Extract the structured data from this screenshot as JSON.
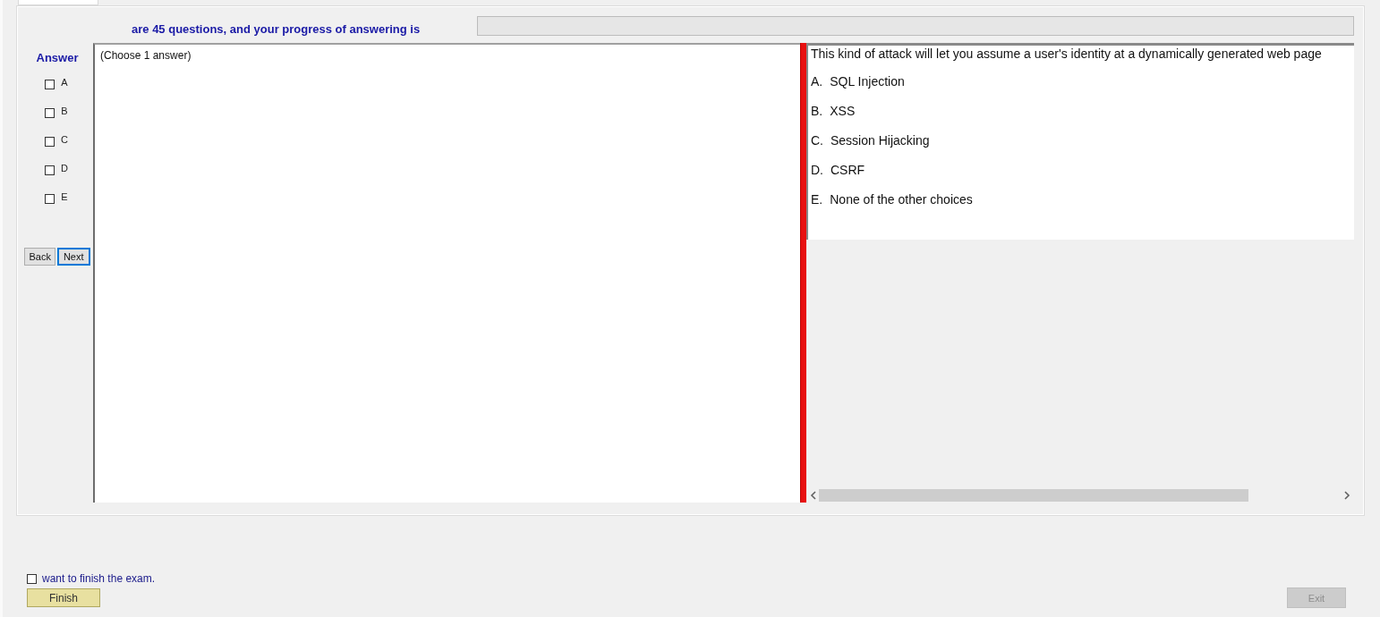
{
  "header": {
    "text": "are 45 questions, and your progress of answering is",
    "progress": {
      "level": 0
    }
  },
  "answer_panel": {
    "title": "Answer",
    "options": [
      {
        "label": "A",
        "checked": false
      },
      {
        "label": "B",
        "checked": false
      },
      {
        "label": "C",
        "checked": false
      },
      {
        "label": "D",
        "checked": false
      },
      {
        "label": "E",
        "checked": false
      }
    ],
    "buttons": [
      {
        "label": "Back",
        "focused": false
      },
      {
        "label": "Next",
        "focused": true
      }
    ]
  },
  "instruction": "(Choose 1 answer)",
  "question": {
    "text": "This kind of attack will let you assume a user's identity at a dynamically generated web page",
    "choices": [
      {
        "letter": "A.",
        "text": "SQL Injection"
      },
      {
        "letter": "B.",
        "text": "XSS"
      },
      {
        "letter": "C.",
        "text": "Session Hijacking"
      },
      {
        "letter": "D.",
        "text": "CSRF"
      },
      {
        "letter": "E.",
        "text": "None of the other choices"
      }
    ]
  },
  "finish": {
    "label": "want to finish the exam.",
    "checked": false,
    "button": "Finish"
  },
  "exit": {
    "label": "Exit",
    "disabled": true
  }
}
